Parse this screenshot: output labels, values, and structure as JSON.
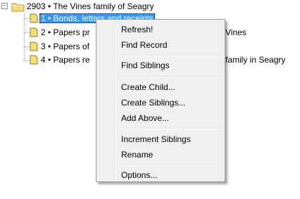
{
  "tree": {
    "root": {
      "expander": "-",
      "label": "2903 • The Vines family of Seagry"
    },
    "children": [
      {
        "label": "1 • Bonds, letters and receipts",
        "selected": true
      },
      {
        "label": "2 • Papers pr",
        "tail": "Vines"
      },
      {
        "label": "3 • Papers of"
      },
      {
        "label": "4 • Papers re",
        "tail": "family in Seagry"
      }
    ]
  },
  "context_menu": {
    "items": [
      "Refresh!",
      "Find Record",
      "Find Siblings",
      "Create Child...",
      "Create Siblings...",
      "Add Above...",
      "Increment Siblings",
      "Rename",
      "Options..."
    ]
  }
}
